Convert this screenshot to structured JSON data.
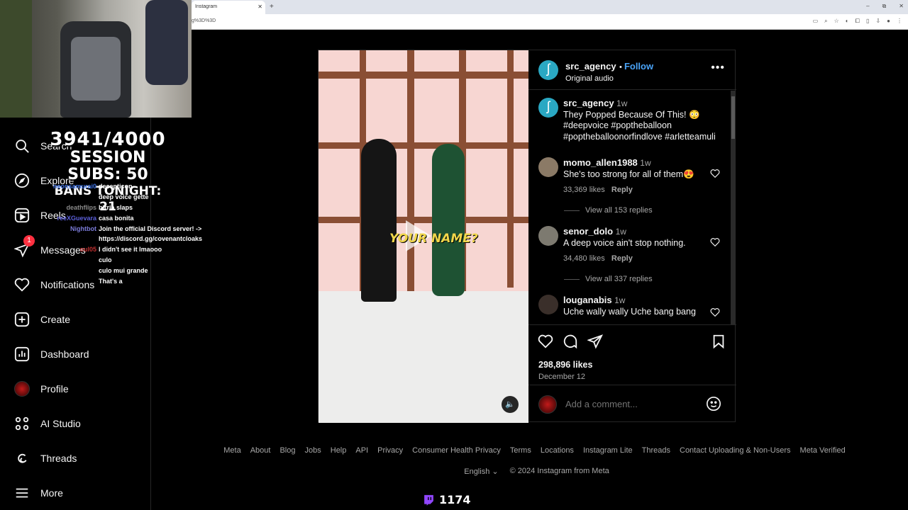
{
  "browser": {
    "tab_title": "Instagram",
    "url": "g%3D%3D"
  },
  "stream": {
    "goal": "3941/4000",
    "session_subs": "SESSION SUBS: 50",
    "bans": "BANS TONIGHT: 21",
    "viewer_count": "1174",
    "chat": [
      {
        "user": "neonsamurai0",
        "msg": "decepticon",
        "color": "#3b6fe0"
      },
      {
        "user": "",
        "msg": "deep voice gette",
        "color": "#cc2b2b"
      },
      {
        "user": "deathflips",
        "msg": "birria slaps",
        "color": "#8a8a8a"
      },
      {
        "user": "reeXGuevara",
        "msg": "casa bonita",
        "color": "#5b5fd9"
      },
      {
        "user": "Nightbot",
        "msg": "Join the official Discord server! ->",
        "color": "#7b7bd8"
      },
      {
        "user": "",
        "msg": "https://discord.gg/covenantcloaks",
        "color": "#fff"
      },
      {
        "user": "oul05",
        "msg": "I didn't see it lmaooo",
        "color": "#c03030"
      },
      {
        "user": "",
        "msg": "culo",
        "color": "#1a2ba8"
      },
      {
        "user": "",
        "msg": "culo mui grande",
        "color": "#1a2ba8"
      },
      {
        "user": "",
        "msg": "That's a",
        "color": "#c03030"
      }
    ]
  },
  "sidebar": {
    "items": [
      {
        "label": "Search"
      },
      {
        "label": "Explore"
      },
      {
        "label": "Reels"
      },
      {
        "label": "Messages",
        "badge": "1"
      },
      {
        "label": "Notifications"
      },
      {
        "label": "Create"
      },
      {
        "label": "Dashboard"
      },
      {
        "label": "Profile"
      },
      {
        "label": "AI Studio"
      },
      {
        "label": "Threads"
      },
      {
        "label": "More"
      }
    ]
  },
  "post": {
    "video_caption": "YOUR NAME?",
    "author": "src_agency",
    "follow_label": "Follow",
    "audio": "Original audio",
    "caption": {
      "user": "src_agency",
      "time": "1w",
      "text": "They Popped Because Of This! 😳",
      "hashtags_line1": "#deepvoice #poptheballoon",
      "hashtags_line2": "#poptheballoonorfindlove #arletteamuli"
    },
    "comments": [
      {
        "user": "momo_allen1988",
        "time": "1w",
        "text": "She's too strong for all of them😍",
        "likes": "33,369 likes",
        "reply": "Reply",
        "view_all": "View all 153 replies"
      },
      {
        "user": "senor_dolo",
        "time": "1w",
        "text": "A deep voice ain't stop nothing.",
        "likes": "34,480 likes",
        "reply": "Reply",
        "view_all": "View all 337 replies"
      },
      {
        "user": "louganabis",
        "time": "1w",
        "text": "Uche wally wally Uche bang bang"
      }
    ],
    "likes": "298,896 likes",
    "date": "December 12",
    "add_comment_placeholder": "Add a comment..."
  },
  "footer": {
    "links": [
      "Meta",
      "About",
      "Blog",
      "Jobs",
      "Help",
      "API",
      "Privacy",
      "Consumer Health Privacy",
      "Terms",
      "Locations",
      "Instagram Lite",
      "Threads",
      "Contact Uploading & Non-Users",
      "Meta Verified"
    ],
    "language": "English",
    "copyright": "© 2024 Instagram from Meta"
  },
  "colors": {
    "accent": "#4aa3f7",
    "badge": "#ff3040",
    "brand_avatar": "#2aa8c3"
  }
}
